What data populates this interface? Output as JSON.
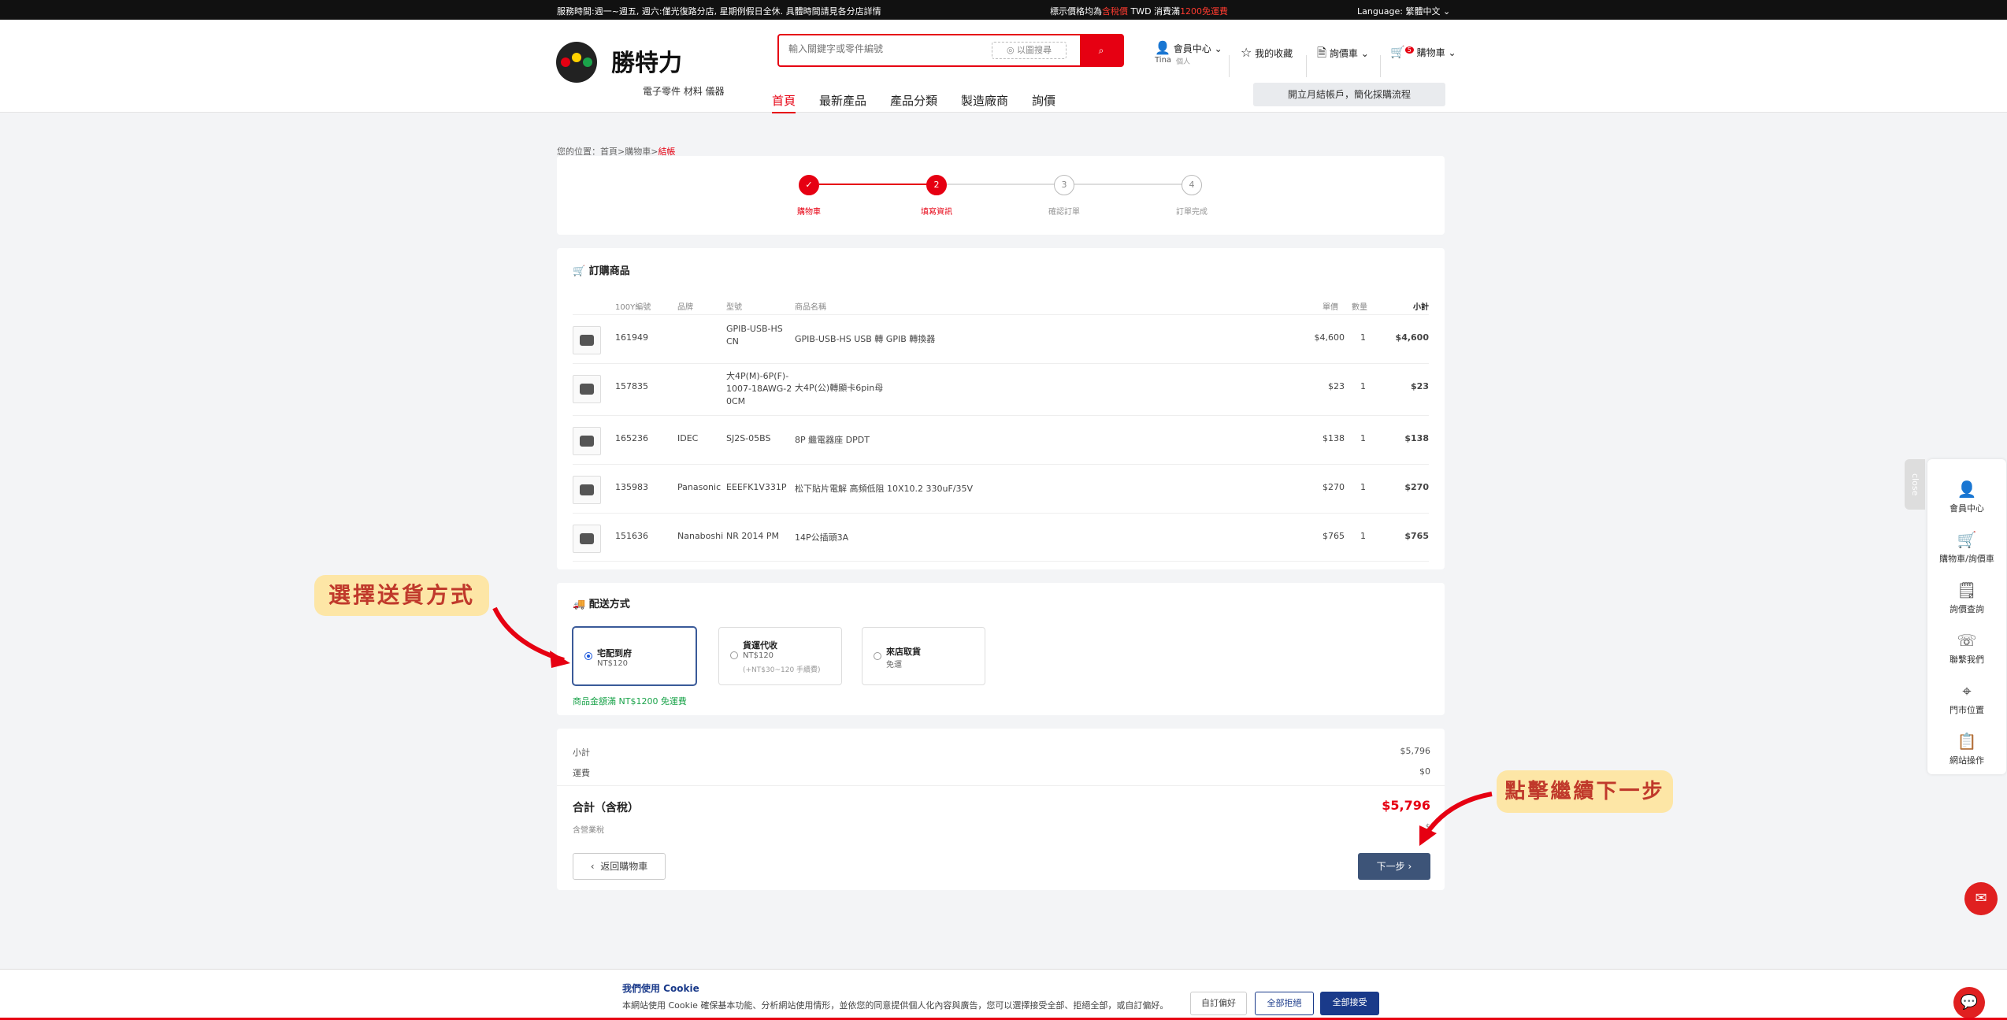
{
  "topbar": {
    "hours": "服務時間:週一~週五, 週六:僅光復路分店, 星期例假日全休. 具體時間請見各分店詳情",
    "price_pre": "標示價格均為",
    "price_tax": "含稅價",
    "price_mid": "TWD 消費滿",
    "price_free": "1200免運費",
    "language_label": "Language:",
    "language_value": "繁體中文"
  },
  "header": {
    "logo_name": "勝特力",
    "logo_sub": "電子零件 材料 儀器",
    "search_placeholder": "輸入關鍵字或零件編號",
    "image_search": "以圖搜尋",
    "member": "會員中心",
    "user": "Tina",
    "user_type": "個人",
    "favorites": "我的收藏",
    "quote": "詢價車",
    "cart": "購物車",
    "cart_count": "5",
    "promo": "開立月結帳戶，簡化採購流程"
  },
  "nav": [
    {
      "label": "首頁"
    },
    {
      "label": "最新產品"
    },
    {
      "label": "產品分類"
    },
    {
      "label": "製造廠商"
    },
    {
      "label": "詢價"
    }
  ],
  "breadcrumb": {
    "prefix": "您的位置：首頁>購物車>",
    "current": "結帳"
  },
  "steps": [
    {
      "num": "✓",
      "label": "購物車"
    },
    {
      "num": "2",
      "label": "填寫資訊"
    },
    {
      "num": "3",
      "label": "確認訂單"
    },
    {
      "num": "4",
      "label": "訂單完成"
    }
  ],
  "order": {
    "title": "訂購商品",
    "headers": {
      "code": "100Y編號",
      "brand": "品牌",
      "model": "型號",
      "name": "商品名稱",
      "price": "單價",
      "qty": "數量",
      "subtotal": "小計"
    },
    "items": [
      {
        "code": "161949",
        "brand": "",
        "model": "GPIB-USB-HS CN",
        "name": "GPIB-USB-HS USB 轉 GPIB 轉換器",
        "price": "$4,600",
        "qty": "1",
        "subtotal": "$4,600"
      },
      {
        "code": "157835",
        "brand": "",
        "model": "大4P(M)-6P(F)-1007-18AWG-20CM",
        "name": "大4P(公)轉顯卡6pin母",
        "price": "$23",
        "qty": "1",
        "subtotal": "$23"
      },
      {
        "code": "165236",
        "brand": "IDEC",
        "model": "SJ2S-05BS",
        "name": "8P 繼電器座 DPDT",
        "price": "$138",
        "qty": "1",
        "subtotal": "$138"
      },
      {
        "code": "135983",
        "brand": "Panasonic",
        "model": "EEEFK1V331P",
        "name": "松下貼片電解 高頻低阻 10X10.2 330uF/35V",
        "price": "$270",
        "qty": "1",
        "subtotal": "$270"
      },
      {
        "code": "151636",
        "brand": "Nanaboshi",
        "model": "NR 2014 PM",
        "name": "14P公插頭3A",
        "price": "$765",
        "qty": "1",
        "subtotal": "$765"
      }
    ]
  },
  "shipping": {
    "title": "配送方式",
    "options": [
      {
        "title": "宅配到府",
        "price": "NT$120",
        "note": ""
      },
      {
        "title": "貨運代收",
        "price": "NT$120",
        "note": "(+NT$30~120 手續費)"
      },
      {
        "title": "來店取貨",
        "price": "免運",
        "note": ""
      }
    ],
    "free_note": "商品金額滿 NT$1200 免運費"
  },
  "summary": {
    "subtotal_label": "小計",
    "subtotal": "$5,796",
    "shipping_label": "運費",
    "shipping": "$0",
    "total_label": "合計（含稅）",
    "total": "$5,796",
    "tax_label": "含營業稅",
    "tax": "$",
    "back": "返回購物車",
    "next": "下一步"
  },
  "callouts": {
    "shipping": "選擇送貨方式",
    "next": "點擊繼續下一步"
  },
  "sidebar": {
    "close": "close",
    "items": [
      {
        "label": "會員中心"
      },
      {
        "label": "購物車/詢價車"
      },
      {
        "label": "詢價查詢"
      },
      {
        "label": "聯繫我們"
      },
      {
        "label": "門市位置"
      },
      {
        "label": "網站操作"
      }
    ]
  },
  "cookie": {
    "title": "我們使用 Cookie",
    "desc": "本網站使用 Cookie 確保基本功能、分析網站使用情形，並依您的同意提供個人化內容與廣告，您可以選擇接受全部、拒絕全部，或自訂偏好。",
    "custom": "自訂偏好",
    "reject": "全部拒絕",
    "accept": "全部接受"
  },
  "colors": {
    "brand": "#e60012",
    "primary_btn": "#3d5478",
    "accept": "#1a3a8a"
  }
}
